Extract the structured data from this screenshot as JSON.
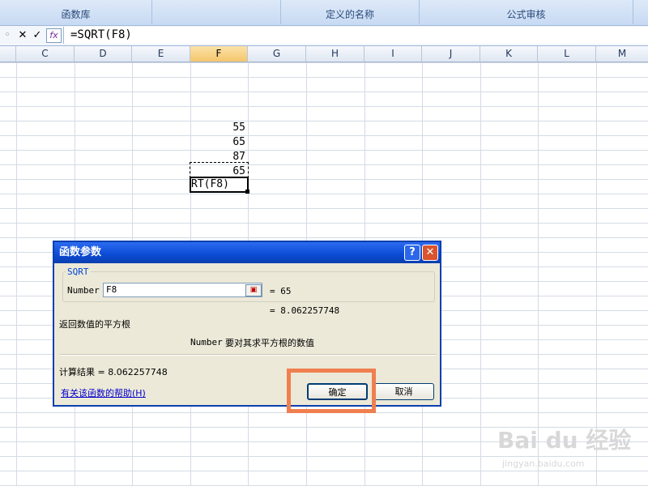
{
  "ribbon": {
    "groups": [
      "函数库",
      "定义的名称",
      "公式审核"
    ]
  },
  "formula_bar": {
    "cancel": "✕",
    "enter": "✓",
    "fx": "fx",
    "content": "=SQRT(F8)"
  },
  "columns": [
    "C",
    "D",
    "E",
    "F",
    "G",
    "H",
    "I",
    "J",
    "K",
    "L",
    "M"
  ],
  "selected_column": "F",
  "cells": {
    "f4": "55",
    "f5": "65",
    "f6": "87",
    "f7": "65",
    "f8_edit": "RT(F8)"
  },
  "dialog": {
    "title": "函数参数",
    "help_btn": "?",
    "close_btn": "✕",
    "function_name": "SQRT",
    "arg_label": "Number",
    "arg_value": "F8",
    "arg_result": "= 65",
    "func_result": "= 8.062257748",
    "description": "返回数值的平方根",
    "arg_desc_name": "Number",
    "arg_desc": "要对其求平方根的数值",
    "calc_result": "计算结果 = 8.062257748",
    "help_link": "有关该函数的帮助(H)",
    "ok": "确定",
    "cancel": "取消"
  },
  "colors": {
    "highlight": "#f07f4f",
    "title_bar": "#0b4ad4",
    "dialog_bg": "#ece9d8",
    "link": "#0000cc"
  },
  "watermark": {
    "brand": "Bai du 经验",
    "url": "jingyan.baidu.com"
  }
}
